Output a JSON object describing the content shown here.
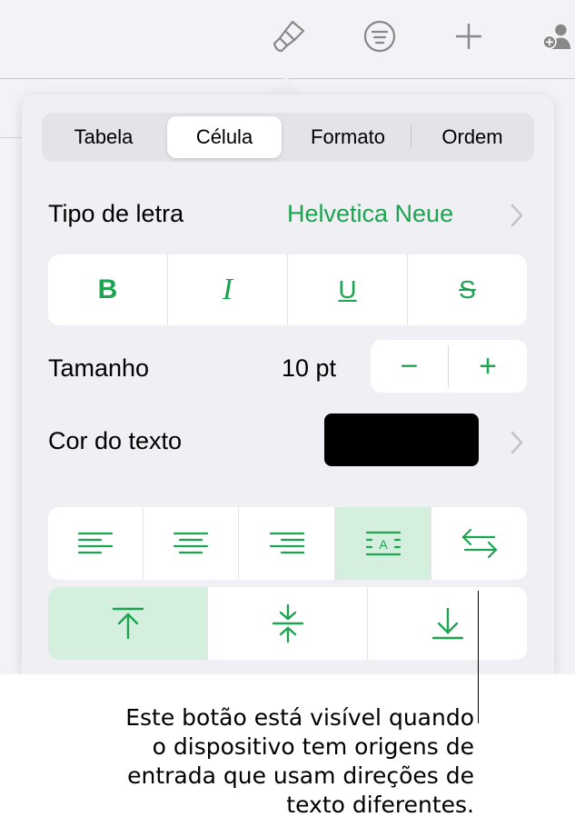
{
  "toolbar": {
    "icons": [
      "paintbrush-icon",
      "list-menu-icon",
      "plus-icon",
      "add-person-icon"
    ]
  },
  "tabs": [
    {
      "label": "Tabela",
      "active": false
    },
    {
      "label": "Célula",
      "active": true
    },
    {
      "label": "Formato",
      "active": false
    },
    {
      "label": "Ordem",
      "active": false
    }
  ],
  "font": {
    "label": "Tipo de letra",
    "value": "Helvetica Neue"
  },
  "text_style": {
    "bold": "B",
    "italic": "I",
    "underline": "U",
    "strikethrough": "S"
  },
  "size": {
    "label": "Tamanho",
    "value": "10 pt",
    "decrement": "−",
    "increment": "+"
  },
  "text_color": {
    "label": "Cor do texto",
    "swatch": "#000000"
  },
  "alignment": {
    "horizontal": [
      "align-left-icon",
      "align-center-icon",
      "align-right-icon",
      "auto-align-icon",
      "text-direction-icon"
    ],
    "selected_horizontal": "auto-align-icon",
    "vertical": [
      "align-top-icon",
      "align-middle-icon",
      "align-bottom-icon"
    ],
    "selected_vertical": "align-top-icon"
  },
  "colors": {
    "accent": "#1ca451",
    "selected_bg": "#d5efdf",
    "popover_bg": "#efeff4"
  },
  "callout": {
    "lines": [
      "Este botão está visível quando",
      "o dispositivo tem origens de",
      "entrada que usam direções de",
      "texto diferentes."
    ]
  }
}
